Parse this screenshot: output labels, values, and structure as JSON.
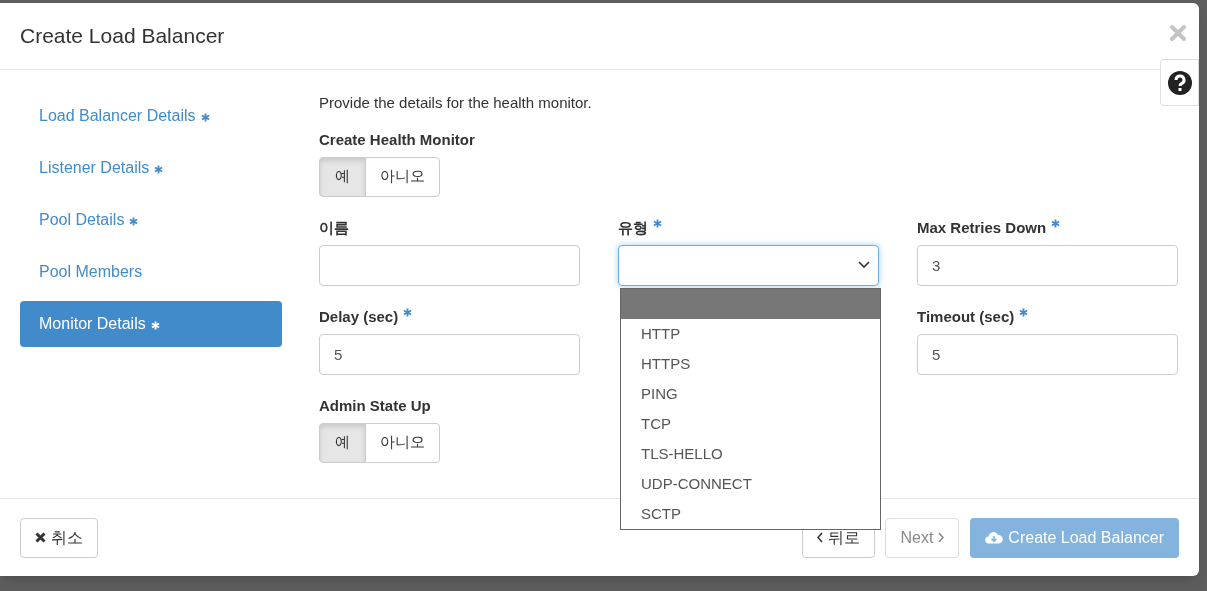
{
  "dialog": {
    "title": "Create Load Balancer"
  },
  "sidebar": {
    "items": [
      {
        "label": "Load Balancer Details",
        "required": true,
        "selected": false
      },
      {
        "label": "Listener Details",
        "required": true,
        "selected": false
      },
      {
        "label": "Pool Details",
        "required": true,
        "selected": false
      },
      {
        "label": "Pool Members",
        "required": false,
        "selected": false
      },
      {
        "label": "Monitor Details",
        "required": true,
        "selected": true
      }
    ]
  },
  "intro": "Provide the details for the health monitor.",
  "fields": [
    {
      "kind": "toggle",
      "label": "Create Health Monitor",
      "required": false,
      "options": [
        {
          "label": "예",
          "selected": true
        },
        {
          "label": "아니오",
          "selected": false
        }
      ]
    },
    {
      "kind": "text",
      "label": "이름",
      "required": false
    },
    {
      "kind": "select",
      "label": "유형",
      "required": true,
      "open": true,
      "options": [
        {
          "label": "HTTP",
          "selected": false
        },
        {
          "label": "HTTPS",
          "selected": false
        },
        {
          "label": "PING",
          "selected": false
        },
        {
          "label": "TCP",
          "selected": false
        },
        {
          "label": "TLS-HELLO",
          "selected": false
        },
        {
          "label": "UDP-CONNECT",
          "selected": false
        },
        {
          "label": "SCTP",
          "selected": false
        }
      ]
    },
    {
      "kind": "text",
      "label": "Max Retries Down",
      "required": true,
      "value": "3"
    },
    {
      "kind": "text",
      "label": "Delay (sec)",
      "required": true,
      "value": "5"
    },
    {
      "kind": "text",
      "label": "Timeout (sec)",
      "required": true,
      "value": "5"
    },
    {
      "kind": "toggle",
      "label": "Admin State Up",
      "required": false,
      "options": [
        {
          "label": "예",
          "selected": true
        },
        {
          "label": "아니오",
          "selected": false
        }
      ]
    }
  ],
  "footer": {
    "buttons": [
      {
        "kind": "cancel",
        "label": "취소",
        "disabled": false
      },
      {
        "kind": "back",
        "label": "뒤로",
        "disabled": false
      },
      {
        "kind": "next",
        "label": "Next",
        "disabled": true
      },
      {
        "kind": "create",
        "label": "Create Load Balancer",
        "disabled": true
      }
    ]
  }
}
